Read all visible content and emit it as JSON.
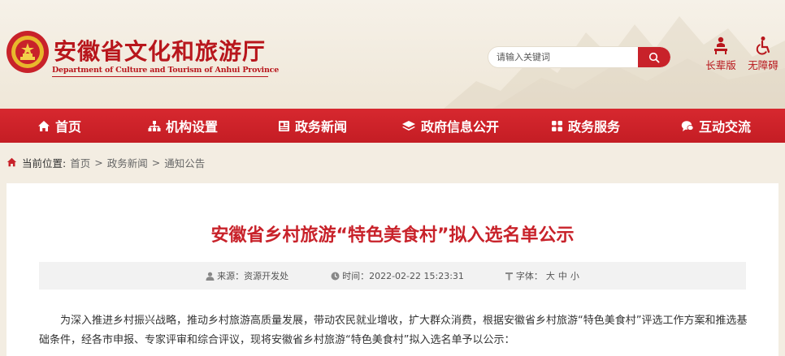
{
  "header": {
    "title_cn": "安徽省文化和旅游厅",
    "title_en": "Department of Culture and Tourism of Anhui Province",
    "search": {
      "placeholder": "请输入关键词"
    },
    "tools": [
      {
        "label": "长辈版",
        "icon": "elder-icon"
      },
      {
        "label": "无障碍",
        "icon": "accessibility-icon"
      }
    ]
  },
  "nav": [
    {
      "label": "首页",
      "icon": "home-icon"
    },
    {
      "label": "机构设置",
      "icon": "org-chart-icon"
    },
    {
      "label": "政务新闻",
      "icon": "news-icon"
    },
    {
      "label": "政府信息公开",
      "icon": "layers-icon"
    },
    {
      "label": "政务服务",
      "icon": "grid-icon"
    },
    {
      "label": "互动交流",
      "icon": "chat-icon"
    }
  ],
  "breadcrumb": {
    "prefix": "当前位置:",
    "items": [
      "首页",
      "政务新闻",
      "通知公告"
    ],
    "separator": ">"
  },
  "article": {
    "title": "安徽省乡村旅游“特色美食村”拟入选名单公示",
    "source": "来源：资源开发处",
    "time": "时间：2022-02-22 15:23:31",
    "font_label": "字体：",
    "font_sizes": [
      "大",
      "中",
      "小"
    ],
    "body": "为深入推进乡村振兴战略，推动乡村旅游高质量发展，带动农民就业增收，扩大群众消费，根据安徽省乡村旅游“特色美食村”评选工作方案和推选基础条件，经各市申报、专家评审和综合评议，现将安徽省乡村旅游“特色美食村”拟入选名单予以公示："
  },
  "colors": {
    "brand_red": "#c8222a",
    "nav_red": "#d7282f",
    "page_bg": "#f3ede2"
  }
}
